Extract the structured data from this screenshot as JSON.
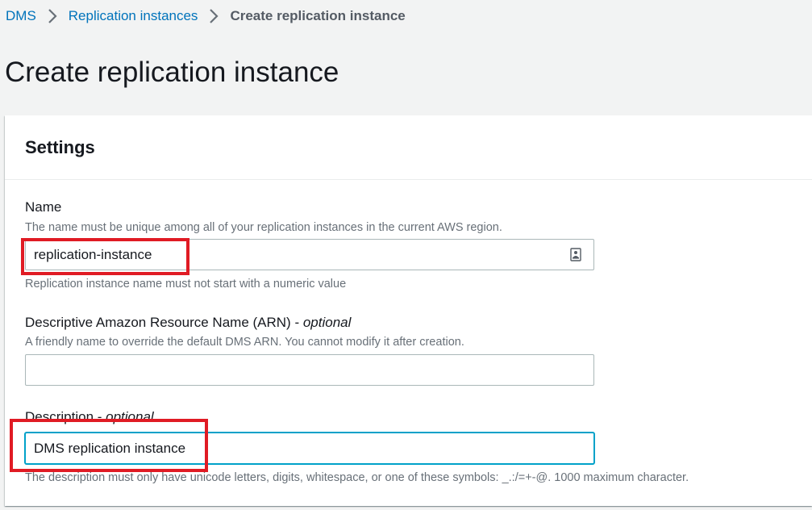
{
  "breadcrumb": {
    "items": [
      "DMS",
      "Replication instances"
    ],
    "current": "Create replication instance"
  },
  "page": {
    "title": "Create replication instance"
  },
  "settings": {
    "title": "Settings",
    "name": {
      "label": "Name",
      "description": "The name must be unique among all of your replication instances in the current AWS region.",
      "value": "replication-instance",
      "constraint": "Replication instance name must not start with a numeric value",
      "icon": "contact-card-icon"
    },
    "arn": {
      "label": "Descriptive Amazon Resource Name (ARN) - ",
      "optional": "optional",
      "description": "A friendly name to override the default DMS ARN. You cannot modify it after creation.",
      "value": ""
    },
    "description": {
      "label": "Description - ",
      "optional": "optional",
      "value": "DMS replication instance",
      "constraint": "The description must only have unicode letters, digits, whitespace, or one of these symbols: _.:/=+-@. 1000 maximum character."
    }
  },
  "colors": {
    "link": "#0073bb",
    "highlight": "#e01b24",
    "focus": "#00a1c9"
  }
}
